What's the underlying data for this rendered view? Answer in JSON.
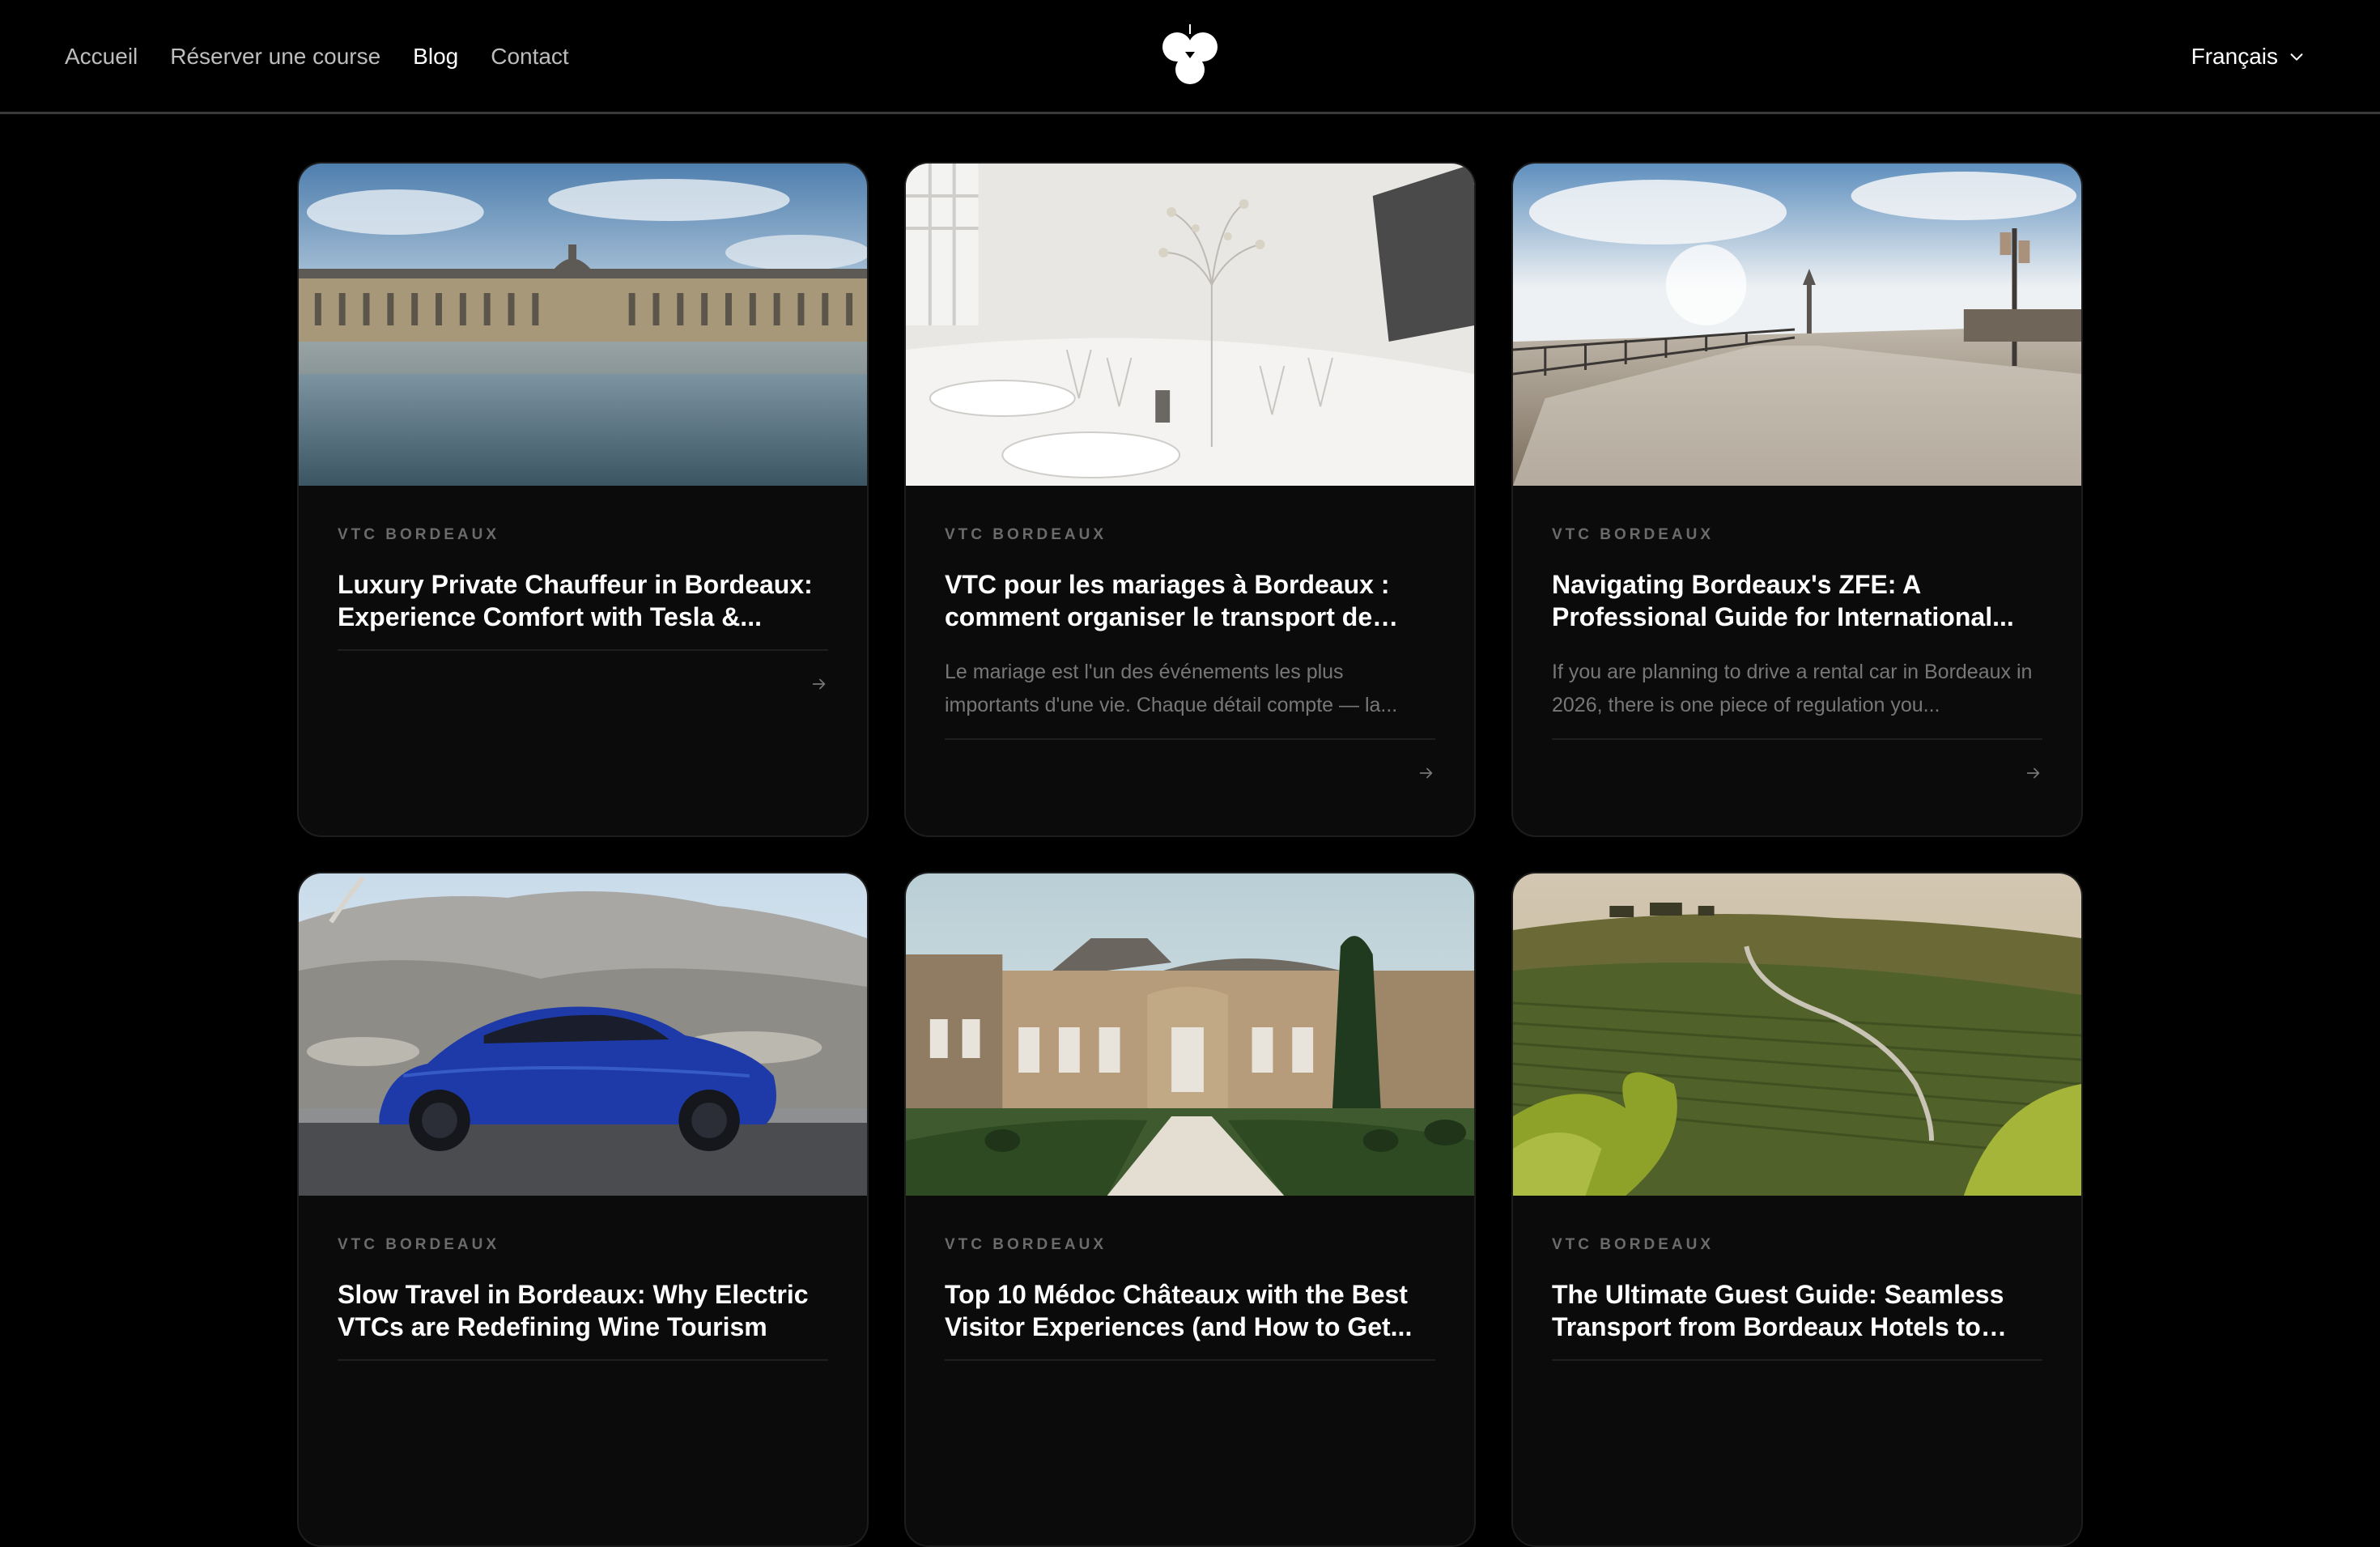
{
  "nav": {
    "items": [
      {
        "label": "Accueil",
        "active": false
      },
      {
        "label": "Réserver une course",
        "active": false
      },
      {
        "label": "Blog",
        "active": true
      },
      {
        "label": "Contact",
        "active": false
      }
    ]
  },
  "logo": {
    "icon": "trefoil-logo-icon"
  },
  "language": {
    "label": "Français",
    "icon": "chevron-down-icon"
  },
  "posts": [
    {
      "category": "VTC BORDEAUX",
      "title": "Luxury Private Chauffeur in Bordeaux: Experience Comfort with Tesla &...",
      "excerpt": "",
      "image": "place-de-la-bourse-photo"
    },
    {
      "category": "VTC BORDEAUX",
      "title": "VTC pour les mariages à Bordeaux : comment organiser le transport de vot...",
      "excerpt": "Le mariage est l'un des événements les plus importants d'une vie. Chaque détail compte — la...",
      "image": "wedding-table-photo"
    },
    {
      "category": "VTC BORDEAUX",
      "title": "Navigating Bordeaux's ZFE: A Professional Guide for International...",
      "excerpt": "If you are planning to drive a rental car in Bordeaux in 2026, there is one piece of regulation you...",
      "image": "quays-promenade-photo"
    },
    {
      "category": "VTC BORDEAUX",
      "title": "Slow Travel in Bordeaux: Why Electric VTCs are Redefining Wine Tourism",
      "excerpt": "",
      "image": "blue-tesla-photo"
    },
    {
      "category": "VTC BORDEAUX",
      "title": "Top 10 Médoc Châteaux with the Best Visitor Experiences (and How to Get...",
      "excerpt": "",
      "image": "medoc-chateau-photo"
    },
    {
      "category": "VTC BORDEAUX",
      "title": "The Ultimate Guest Guide: Seamless Transport from Bordeaux Hotels to the...",
      "excerpt": "",
      "image": "vineyard-hills-photo"
    }
  ],
  "colors": {
    "background": "#000000",
    "card": "#0b0b0b",
    "text": "#ffffff",
    "muted": "#777777"
  }
}
